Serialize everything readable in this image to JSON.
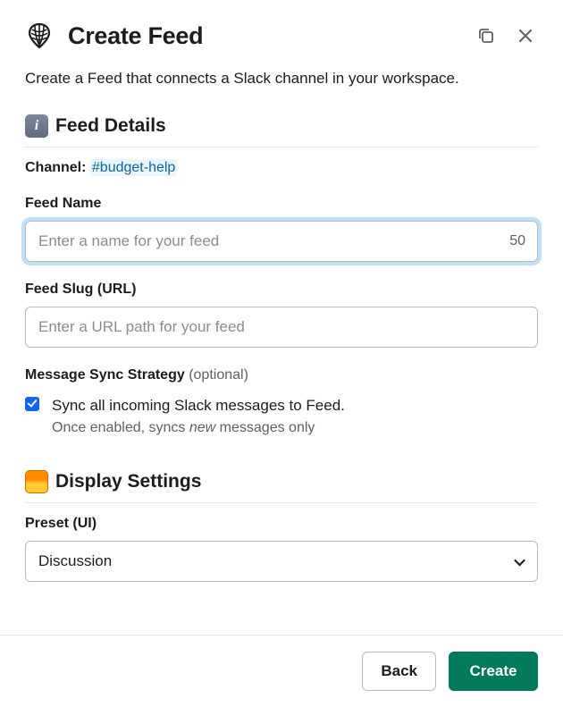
{
  "header": {
    "title": "Create Feed"
  },
  "intro": "Create a Feed that connects a Slack channel in your workspace.",
  "sections": {
    "details": {
      "title": "Feed Details",
      "channel_label": "Channel",
      "channel_value": "#budget-help",
      "name": {
        "label": "Feed Name",
        "placeholder": "Enter a name for your feed",
        "value": "",
        "remaining": "50"
      },
      "slug": {
        "label": "Feed Slug (URL)",
        "placeholder": "Enter a URL path for your feed",
        "value": ""
      },
      "sync": {
        "label": "Message Sync Strategy",
        "optional": "(optional)",
        "checkbox_label": "Sync all incoming Slack messages to Feed.",
        "checkbox_sub_prefix": "Once enabled, syncs ",
        "checkbox_sub_em": "new",
        "checkbox_sub_suffix": " messages only",
        "checked": true
      }
    },
    "display": {
      "title": "Display Settings",
      "preset": {
        "label": "Preset (UI)",
        "value": "Discussion"
      }
    }
  },
  "footer": {
    "back": "Back",
    "create": "Create"
  }
}
